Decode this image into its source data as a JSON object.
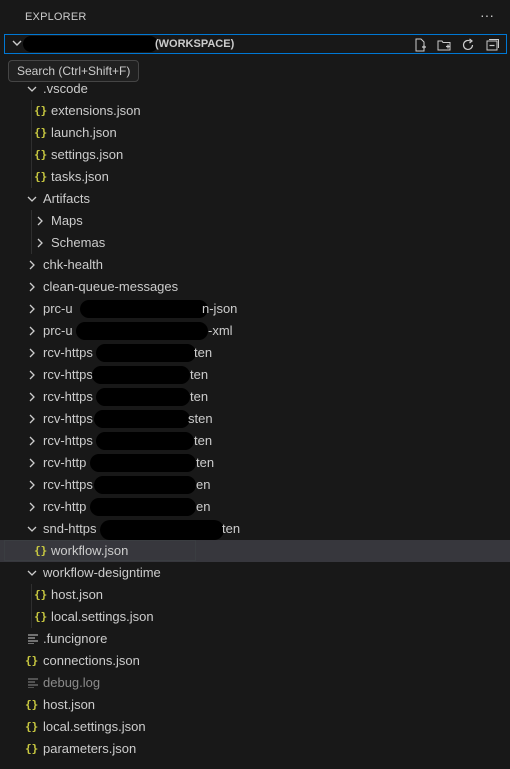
{
  "header": {
    "title": "EXPLORER",
    "more_icon": "ellipsis-icon"
  },
  "section": {
    "title": "(WORKSPACE)",
    "actions": [
      "new-file-icon",
      "new-folder-icon",
      "refresh-icon",
      "collapse-all-icon"
    ]
  },
  "tooltip": {
    "text": "Search (Ctrl+Shift+F)"
  },
  "tree": {
    "vscode": ".vscode",
    "extensions": "extensions.json",
    "launch": "launch.json",
    "settings": "settings.json",
    "tasks": "tasks.json",
    "artifacts": "Artifacts",
    "maps": "Maps",
    "schemas": "Schemas",
    "chk_health": "chk-health",
    "clean_queue": "clean-queue-messages",
    "prc1_start": "prc-u",
    "prc1_end": "n-json",
    "prc2_start": "prc-u",
    "prc2_end": "-xml",
    "rcv1_start": "rcv-https",
    "rcv1_end": "ten",
    "rcv2_start": "rcv-https",
    "rcv2_end": "ten",
    "rcv3_start": "rcv-https",
    "rcv3_end": "ten",
    "rcv4_start": "rcv-https",
    "rcv4_end": "sten",
    "rcv5_start": "rcv-https",
    "rcv5_end": "ten",
    "rcv6_start": "rcv-http",
    "rcv6_end": "ten",
    "rcv7_start": "rcv-https",
    "rcv7_end": "en",
    "rcv8_start": "rcv-http",
    "rcv8_end": "en",
    "snd_start": "snd-https",
    "snd_end": "ten",
    "workflow": "workflow.json",
    "wf_designtime": "workflow-designtime",
    "dt_host": "host.json",
    "dt_local_settings": "local.settings.json",
    "funcignore": ".funcignore",
    "connections": "connections.json",
    "debug_log": "debug.log",
    "host": "host.json",
    "local_settings": "local.settings.json",
    "parameters": "parameters.json",
    "json_icon_glyph": "{}"
  },
  "colors": {
    "background": "#181818",
    "focus_border": "#0078d4",
    "json_icon": "#cbcb41",
    "selection": "#37373d"
  }
}
